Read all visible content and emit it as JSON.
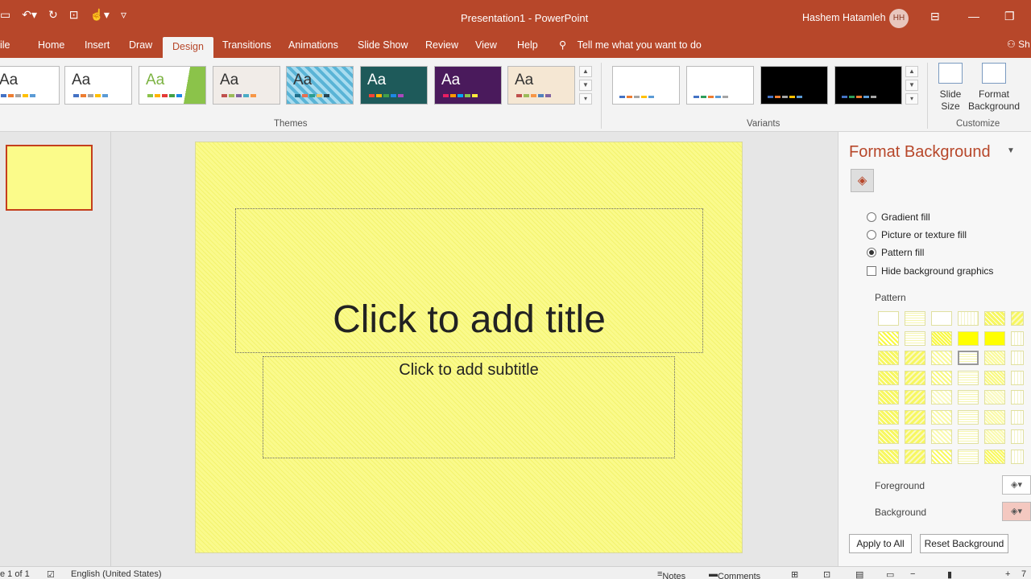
{
  "window": {
    "title": "Presentation1 - PowerPoint",
    "user": "Hashem Hatamleh",
    "avatar_initials": "HH"
  },
  "tabs": [
    "ile",
    "Home",
    "Insert",
    "Draw",
    "Design",
    "Transitions",
    "Animations",
    "Slide Show",
    "Review",
    "View",
    "Help"
  ],
  "active_tab": "Design",
  "tell_me": "Tell me what you want to do",
  "share_label": "Sh",
  "ribbon": {
    "themes_label": "Themes",
    "variants_label": "Variants",
    "customize_label": "Customize",
    "theme_sample": "Aa",
    "slide_size": "Slide Size",
    "format_background": "Format Background"
  },
  "slide": {
    "title_placeholder": "Click to add title",
    "subtitle_placeholder": "Click to add subtitle",
    "background_color": "#fafa8c"
  },
  "format_pane": {
    "title": "Format Background",
    "options": [
      {
        "label": "Gradient fill",
        "selected": false
      },
      {
        "label": "Picture or texture fill",
        "selected": false
      },
      {
        "label": "Pattern fill",
        "selected": true
      }
    ],
    "hide_graphics": "Hide background graphics",
    "pattern_label": "Pattern",
    "foreground_label": "Foreground",
    "background_label": "Background",
    "apply_all": "Apply to All",
    "reset": "Reset Background"
  },
  "status": {
    "slide_count": "e 1 of 1",
    "language": "English (United States)",
    "notes": "Notes",
    "comments": "Comments",
    "zoom": "7"
  },
  "colors": {
    "accent": "#b7472a",
    "pattern_yellow": "#fafa8c"
  }
}
